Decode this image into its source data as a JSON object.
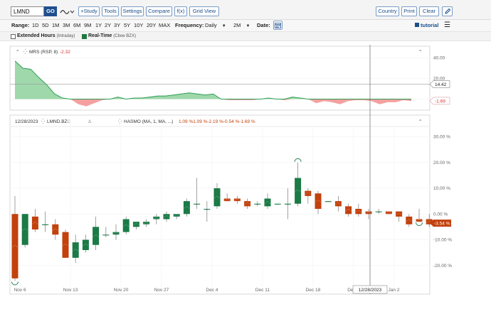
{
  "toolbar": {
    "symbol": "LMND",
    "go_label": "GO",
    "study_label": "+Study",
    "tools_label": "Tools",
    "settings_label": "Settings",
    "compare_label": "Compare",
    "fx_label": "f(x)",
    "gridview_label": "Grid View",
    "country_label": "Country",
    "print_label": "Print",
    "clear_label": "Clear"
  },
  "range_bar": {
    "range_label": "Range:",
    "ranges": [
      "1D",
      "5D",
      "1M",
      "3M",
      "6M",
      "9M",
      "1Y",
      "2Y",
      "3Y",
      "5Y",
      "10Y",
      "20Y",
      "MAX"
    ],
    "frequency_label": "Frequency:",
    "frequency_value": "Daily",
    "period_value": "2M",
    "date_label": "Date:",
    "tutorial_label": "tutorial"
  },
  "legend": {
    "extended_hours": "Extended Hours",
    "extended_hours_note": "(Intraday)",
    "realtime": "Real-Time",
    "realtime_note": "(Cboe BZX)"
  },
  "colors": {
    "up": "#1b7a45",
    "down": "#c2410c",
    "mrs_pos": "#9fd8ab",
    "mrs_neg": "#f5a0a0",
    "accent": "#1f4f8f"
  },
  "upper_panel": {
    "title": "MRS (RSP, 8)",
    "value": "-2.32",
    "y_ticks": [
      "40.00",
      "20.00",
      "0.00"
    ],
    "y_tick_values": [
      40,
      20,
      0
    ],
    "ylim": [
      -10,
      50
    ],
    "last_label": "14.42",
    "last_value": 14.42,
    "zero_label": "-1.69",
    "zero_value": -1.69
  },
  "main_panel": {
    "date": "12/28/2023",
    "symbol": "LMND.BZ",
    "symbol_suffix": "C",
    "triangle_glyph": "Δ",
    "study": "HASMO (MA, 1, MA, ...)",
    "study_values": "1.09 %1.09 %-2.19 %-0.54 %-1.69 %",
    "y_ticks": [
      "30.00 %",
      "20.00 %",
      "10.00 %",
      "0.00 %",
      "-10.00 %",
      "-20.00 %"
    ],
    "y_tick_values": [
      30,
      20,
      10,
      0,
      -10,
      -20
    ],
    "ylim": [
      -30,
      34
    ],
    "last_label": "-3.54 %",
    "last_value": -3.54
  },
  "x_axis": {
    "labels": [
      "Nov 6",
      "Nov 13",
      "Nov 20",
      "Nov 27",
      "Dec 4",
      "Dec 11",
      "Dec 18",
      "Dec 2",
      "Jan 2"
    ],
    "label_index": [
      0.5,
      5.5,
      10.5,
      14.5,
      19.5,
      24.5,
      29.5,
      33.5,
      37.5
    ],
    "crosshair_label": "12/28/2023",
    "crosshair_index": 35
  },
  "chart_data": {
    "type": "candlestick",
    "title": "",
    "xlabel": "",
    "ylabel": "",
    "ylim": [
      -30,
      34
    ],
    "candles": [
      {
        "o": 0,
        "h": 7,
        "l": -26,
        "c": -25
      },
      {
        "o": -12,
        "h": 0,
        "l": -13,
        "c": 0
      },
      {
        "o": -1,
        "h": 2,
        "l": -7,
        "c": -6
      },
      {
        "o": -4,
        "h": 1,
        "l": -7,
        "c": -4
      },
      {
        "o": -4,
        "h": -2,
        "l": -10,
        "c": -8
      },
      {
        "o": -7,
        "h": -6,
        "l": -17,
        "c": -17
      },
      {
        "o": -17,
        "h": -8,
        "l": -19,
        "c": -11
      },
      {
        "o": -14,
        "h": -8,
        "l": -15,
        "c": -10
      },
      {
        "o": -12,
        "h": -1,
        "l": -14,
        "c": -5
      },
      {
        "o": -8,
        "h": -5,
        "l": -9,
        "c": -8
      },
      {
        "o": -8,
        "h": -4,
        "l": -10,
        "c": -7
      },
      {
        "o": -7,
        "h": -1,
        "l": -8,
        "c": -2
      },
      {
        "o": -5,
        "h": -3,
        "l": -6,
        "c": -3
      },
      {
        "o": -4,
        "h": -2,
        "l": -5,
        "c": -3
      },
      {
        "o": -2,
        "h": 0,
        "l": -4,
        "c": -1
      },
      {
        "o": -2,
        "h": 1,
        "l": -3,
        "c": 0
      },
      {
        "o": -1,
        "h": 0,
        "l": -2,
        "c": 0
      },
      {
        "o": 0,
        "h": 6,
        "l": -1,
        "c": 5
      },
      {
        "o": 4,
        "h": 14,
        "l": 2,
        "c": 4
      },
      {
        "o": 2,
        "h": 5,
        "l": -3,
        "c": 2
      },
      {
        "o": 3,
        "h": 12,
        "l": 2,
        "c": 10
      },
      {
        "o": 6,
        "h": 8,
        "l": 5,
        "c": 5
      },
      {
        "o": 6,
        "h": 7,
        "l": 4,
        "c": 5
      },
      {
        "o": 5,
        "h": 6,
        "l": 2,
        "c": 3
      },
      {
        "o": 4,
        "h": 5,
        "l": 3,
        "c": 4
      },
      {
        "o": 3,
        "h": 8,
        "l": 2,
        "c": 6
      },
      {
        "o": 4,
        "h": 4,
        "l": 4,
        "c": 4
      },
      {
        "o": 4,
        "h": 10,
        "l": -2,
        "c": 4
      },
      {
        "o": 4,
        "h": 20,
        "l": 3,
        "c": 14
      },
      {
        "o": 9,
        "h": 10,
        "l": 4,
        "c": 7
      },
      {
        "o": 8,
        "h": 9,
        "l": 0,
        "c": 2
      },
      {
        "o": 5,
        "h": 5,
        "l": 5,
        "c": 5
      },
      {
        "o": 5,
        "h": 7,
        "l": 1,
        "c": 3
      },
      {
        "o": 3,
        "h": 4,
        "l": -1,
        "c": 0
      },
      {
        "o": 2,
        "h": 4,
        "l": -1,
        "c": 0
      },
      {
        "o": 1,
        "h": 2,
        "l": -2,
        "c": 0
      },
      {
        "o": 1,
        "h": 2,
        "l": 0,
        "c": 1
      },
      {
        "o": 1,
        "h": 1,
        "l": 0,
        "c": 0
      },
      {
        "o": 1,
        "h": 1,
        "l": -3,
        "c": -1
      },
      {
        "o": -1,
        "h": 0,
        "l": -5,
        "c": -4
      },
      {
        "o": -2,
        "h": 2,
        "l": -3,
        "c": -3
      },
      {
        "o": -2,
        "h": 0,
        "l": -5,
        "c": -4
      }
    ],
    "mrs": [
      37,
      30,
      29,
      21,
      14,
      5,
      1,
      0,
      -5,
      -7,
      -4,
      -1,
      0,
      2,
      0,
      1,
      1,
      2,
      3,
      3,
      4,
      5,
      6,
      5,
      4,
      5,
      0,
      -1,
      -1,
      -1,
      -1,
      0,
      1,
      0,
      -1,
      2,
      1,
      0,
      -4,
      -2,
      -3,
      -5,
      -2,
      -1,
      -1,
      -2,
      -5,
      -3,
      -3,
      -1,
      -2
    ],
    "circles": [
      0,
      28,
      40
    ]
  }
}
